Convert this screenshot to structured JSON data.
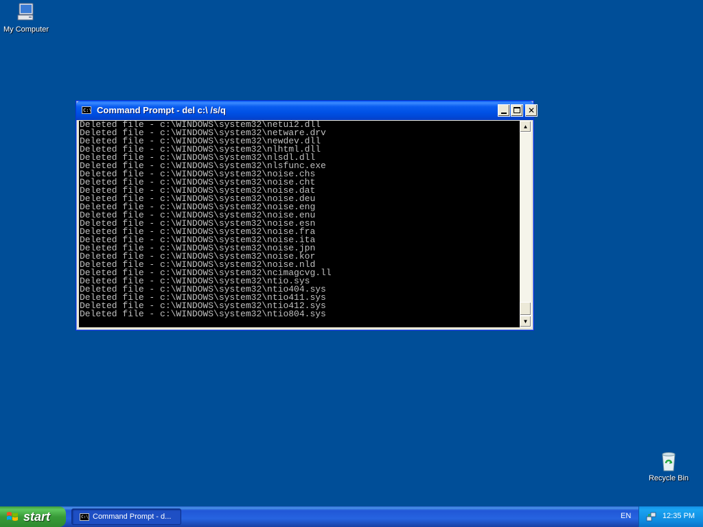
{
  "desktop": {
    "icons": [
      {
        "label": "My Computer",
        "icon": "my-computer-icon"
      },
      {
        "label": "Recycle Bin",
        "icon": "recycle-bin-icon"
      }
    ]
  },
  "window": {
    "title": "Command Prompt - del c:\\ /s/q",
    "icon": "console-icon",
    "buttons": {
      "minimize": "minimize-icon",
      "maximize": "maximize-icon",
      "close": "close-icon"
    },
    "console_lines": [
      "Deleted file - c:\\WINDOWS\\system32\\netui2.dll",
      "Deleted file - c:\\WINDOWS\\system32\\netware.drv",
      "Deleted file - c:\\WINDOWS\\system32\\newdev.dll",
      "Deleted file - c:\\WINDOWS\\system32\\nlhtml.dll",
      "Deleted file - c:\\WINDOWS\\system32\\nlsdl.dll",
      "Deleted file - c:\\WINDOWS\\system32\\nlsfunc.exe",
      "Deleted file - c:\\WINDOWS\\system32\\noise.chs",
      "Deleted file - c:\\WINDOWS\\system32\\noise.cht",
      "Deleted file - c:\\WINDOWS\\system32\\noise.dat",
      "Deleted file - c:\\WINDOWS\\system32\\noise.deu",
      "Deleted file - c:\\WINDOWS\\system32\\noise.eng",
      "Deleted file - c:\\WINDOWS\\system32\\noise.enu",
      "Deleted file - c:\\WINDOWS\\system32\\noise.esn",
      "Deleted file - c:\\WINDOWS\\system32\\noise.fra",
      "Deleted file - c:\\WINDOWS\\system32\\noise.ita",
      "Deleted file - c:\\WINDOWS\\system32\\noise.jpn",
      "Deleted file - c:\\WINDOWS\\system32\\noise.kor",
      "Deleted file - c:\\WINDOWS\\system32\\noise.nld",
      "Deleted file - c:\\WINDOWS\\system32\\ncimagcvg.ll",
      "Deleted file - c:\\WINDOWS\\system32\\ntio.sys",
      "Deleted file - c:\\WINDOWS\\system32\\ntio404.sys",
      "Deleted file - c:\\WINDOWS\\system32\\ntio411.sys",
      "Deleted file - c:\\WINDOWS\\system32\\ntio412.sys",
      "Deleted file - c:\\WINDOWS\\system32\\ntio804.sys"
    ],
    "scrollbar": {
      "up_icon": "scroll-up-arrow-icon",
      "down_icon": "scroll-down-arrow-icon",
      "position": 1.0
    }
  },
  "taskbar": {
    "start_label": "start",
    "task_button_label": "Command Prompt - d...",
    "language": "EN",
    "clock": "12:35 PM"
  },
  "colors": {
    "desktop": "#004e98",
    "console_bg": "#000000",
    "console_text": "#c0c0c0",
    "title_bar": "#0054e3",
    "taskbar": "#245edb",
    "start_button": "#3c9a3c",
    "tray": "#0f8be0"
  }
}
